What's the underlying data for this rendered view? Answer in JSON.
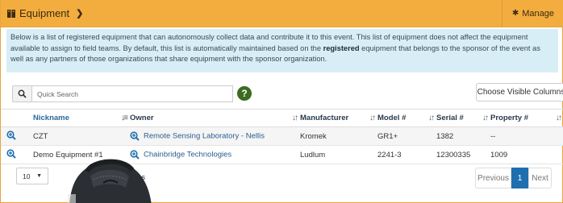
{
  "header": {
    "title": "Equipment",
    "manage_label": "Manage"
  },
  "info": {
    "text_before": "Below is a list of registered equipment that can autonomously collect data and contribute it to this event. This list of equipment does not affect the equipment available to assign to field teams. By default, this list is automatically maintained based on the ",
    "bold": "registered",
    "text_after": " equipment that belongs to the sponsor of the event as well as any partners of those organizations that share equipment with the sponsor organization."
  },
  "toolbar": {
    "search_placeholder": "Quick Search",
    "help_label": "?",
    "columns_button": "Choose Visible Columns"
  },
  "table": {
    "columns": [
      "Nickname",
      "Owner",
      "Manufacturer",
      "Model #",
      "Serial #",
      "Property #"
    ],
    "rows": [
      {
        "nickname": "CZT",
        "owner": "Remote Sensing Laboratory - Nellis",
        "manufacturer": "Kromek",
        "model": "GR1+",
        "serial": "1382",
        "property": "--"
      },
      {
        "nickname": "Demo Equipment #1",
        "owner": "Chainbridge Technologies",
        "manufacturer": "Ludlum",
        "model": "2241-3",
        "serial": "12300335",
        "property": "1009"
      }
    ]
  },
  "footer": {
    "page_length": "10",
    "length_label": "es",
    "previous": "Previous",
    "current_page": "1",
    "next": "Next"
  },
  "colors": {
    "header_bg": "#f3ad3e",
    "info_bg": "#d8eef6",
    "accent": "#1f6fae",
    "help_bg": "#3b6b21"
  },
  "icons": {
    "header": "book-icon",
    "manage": "gear-icon",
    "search": "search-icon",
    "row_action": "zoom-in-icon",
    "length_dropdown": "caret-down-icon"
  }
}
